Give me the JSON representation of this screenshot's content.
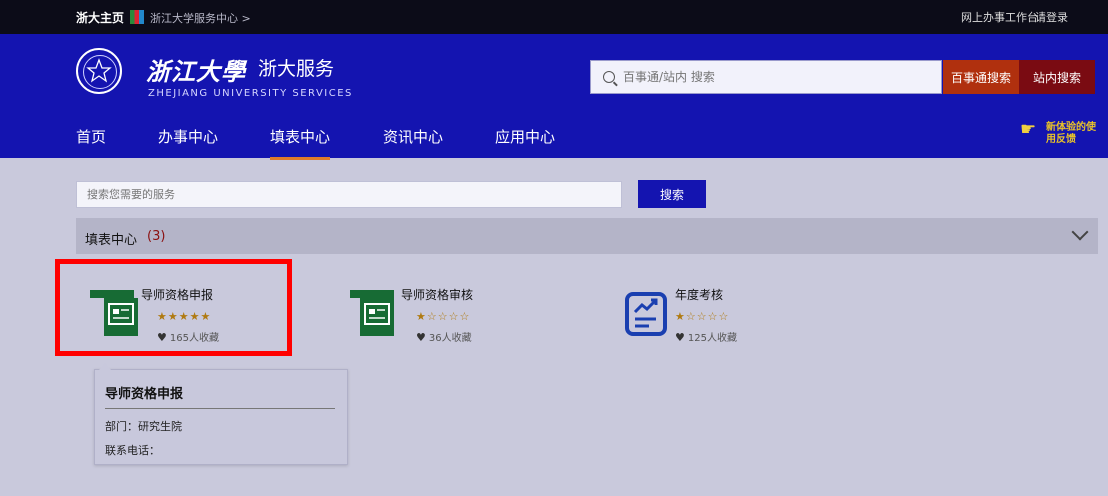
{
  "topbar": {
    "home_label": "浙大主页",
    "breadcrumb": "浙江大学服务中心 >",
    "online_office": "网上办事工作台",
    "login": "请登录"
  },
  "header": {
    "logo_text": "浙江大學",
    "service_title": "浙大服务",
    "subtitle_en": "ZHEJIANG UNIVERSITY SERVICES",
    "search_placeholder": "百事通/站内 搜索",
    "btn_baishitong": "百事通搜索",
    "btn_site": "站内搜索",
    "nav": [
      {
        "label": "首页",
        "active": false
      },
      {
        "label": "办事中心",
        "active": false
      },
      {
        "label": "填表中心",
        "active": true
      },
      {
        "label": "资讯中心",
        "active": false
      },
      {
        "label": "应用中心",
        "active": false
      }
    ],
    "feedback": "新体验的使用反馈"
  },
  "content": {
    "service_search_placeholder": "搜索您需要的服务",
    "search_button": "搜索",
    "section_title": "填表中心",
    "section_count": "(3)",
    "cards": [
      {
        "name": "导师资格申报",
        "stars": "★★★★★",
        "favorites": "165人收藏",
        "icon": "form-icon"
      },
      {
        "name": "导师资格审核",
        "stars": "★☆☆☆☆",
        "favorites": "36人收藏",
        "icon": "form-icon"
      },
      {
        "name": "年度考核",
        "stars": "★☆☆☆☆",
        "favorites": "125人收藏",
        "icon": "chart-doc-icon"
      }
    ],
    "tooltip": {
      "title": "导师资格申报",
      "department": "部门：研究生院",
      "phone": "联系电话："
    }
  },
  "colors": {
    "header_blue": "#1414b0",
    "topbar": "#0c0c18",
    "baishitong_btn": "#b0300e",
    "site_btn": "#7a0b12",
    "highlight_red": "#ff0000",
    "form_icon_green": "#176b34",
    "chart_icon_blue": "#1a3fb0",
    "active_underline": "#e07b2a"
  }
}
